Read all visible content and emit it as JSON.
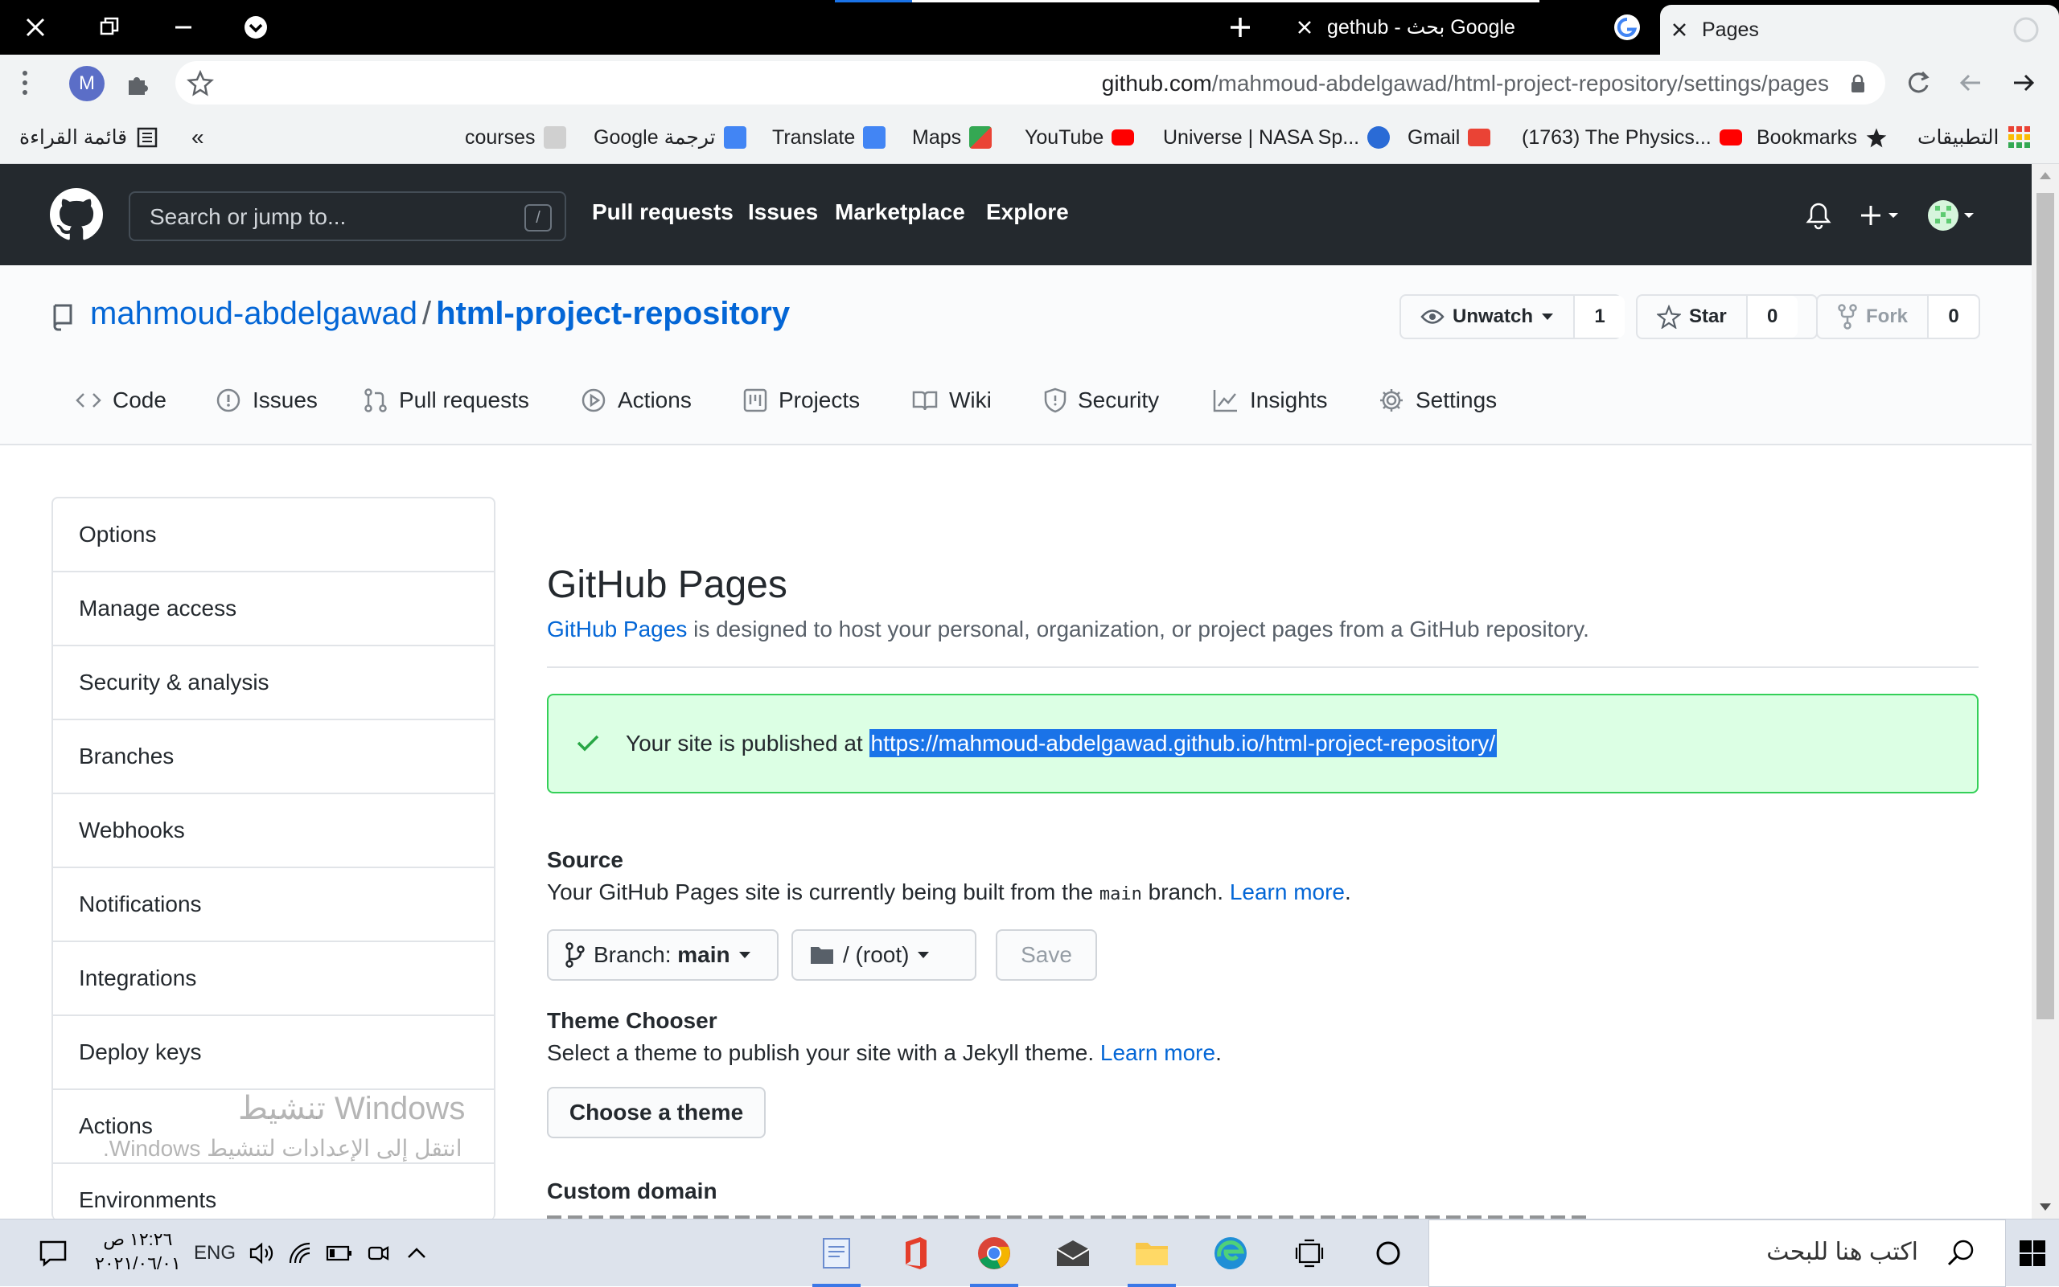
{
  "browser": {
    "tabs": [
      {
        "title": "gethub - بحث Google"
      },
      {
        "title": "Pages"
      }
    ],
    "url_host": "github.com",
    "url_path": "/mahmoud-abdelgawad/html-project-repository/settings/pages",
    "profile_initial": "M",
    "bookmarks": {
      "reading_list": "قائمة القراءة",
      "items": [
        "courses",
        "Google ترجمة",
        "Translate",
        "Maps",
        "YouTube",
        "Universe | NASA Sp...",
        "Gmail",
        "(1763) The Physics...",
        "Bookmarks",
        "التطبيقات"
      ]
    }
  },
  "github": {
    "search_placeholder": "Search or jump to...",
    "search_shortcut": "/",
    "nav": [
      "Pull requests",
      "Issues",
      "Marketplace",
      "Explore"
    ],
    "repo_owner": "mahmoud-abdelgawad",
    "repo_sep": "/",
    "repo_name": "html-project-repository",
    "unwatch": {
      "label": "Unwatch",
      "count": "1"
    },
    "star": {
      "label": "Star",
      "count": "0"
    },
    "fork": {
      "label": "Fork",
      "count": "0"
    },
    "repo_tabs": [
      "Code",
      "Issues",
      "Pull requests",
      "Actions",
      "Projects",
      "Wiki",
      "Security",
      "Insights",
      "Settings"
    ],
    "sidebar": [
      "Options",
      "Manage access",
      "Security & analysis",
      "Branches",
      "Webhooks",
      "Notifications",
      "Integrations",
      "Deploy keys",
      "Actions",
      "Environments"
    ],
    "pages": {
      "title": "GitHub Pages",
      "desc_link": "GitHub Pages",
      "desc_rest": " is designed to host your personal, organization, or project pages from a GitHub repository.",
      "flash_text": "Your site is published at ",
      "flash_url": "https://mahmoud-abdelgawad.github.io/html-project-repository/",
      "source_title": "Source",
      "source_text_1": "Your GitHub Pages site is currently being built from the ",
      "source_branch_code": "main",
      "source_text_2": " branch. ",
      "learn_more": "Learn more",
      "branch_label": "Branch: ",
      "branch_value": "main",
      "folder_label": "/ (root)",
      "save_label": "Save",
      "theme_title": "Theme Chooser",
      "theme_text": "Select a theme to publish your site with a Jekyll theme. ",
      "choose_theme": "Choose a theme",
      "custom_domain_title": "Custom domain"
    }
  },
  "watermark": {
    "line1": "تنشيط Windows",
    "line2": "انتقل إلى الإعدادات لتنشيط Windows."
  },
  "taskbar": {
    "time": "١٢:٢٦ ص",
    "date": "٢٠٢١/٠٦/٠١",
    "lang": "ENG",
    "search_placeholder": "اكتب هنا للبحث"
  }
}
